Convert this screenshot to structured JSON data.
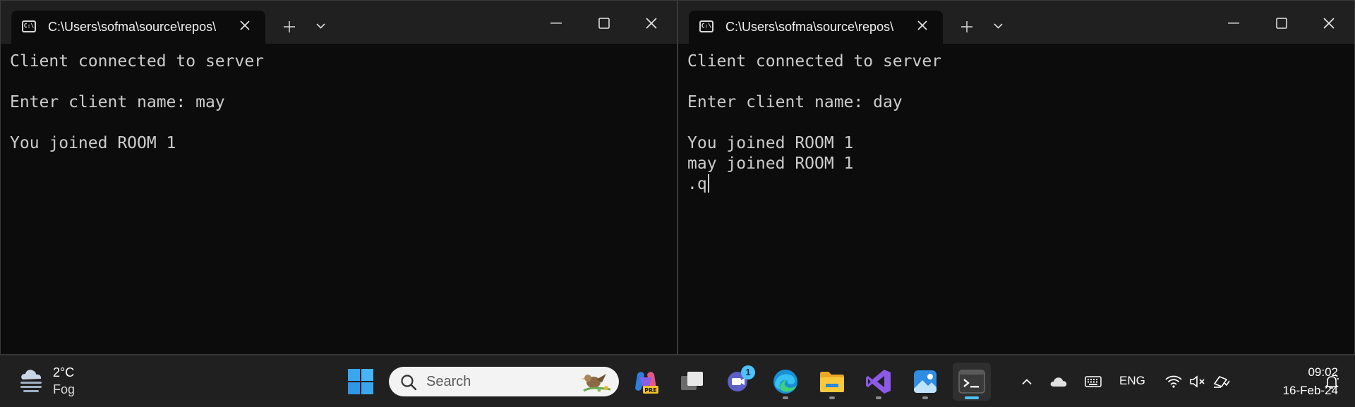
{
  "windows": [
    {
      "tab_title": "C:\\Users\\sofma\\source\\repos\\",
      "tab_icon_glyph": "C:\\",
      "lines": [
        "Client connected to server",
        "",
        "Enter client name: may",
        "",
        "You joined ROOM 1"
      ]
    },
    {
      "tab_title": "C:\\Users\\sofma\\source\\repos\\",
      "tab_icon_glyph": "C:\\",
      "lines": [
        "Client connected to server",
        "",
        "Enter client name: day",
        "",
        "You joined ROOM 1",
        "may joined ROOM 1",
        ".q"
      ]
    }
  ],
  "icons": {
    "tab": "terminal-tab-icon",
    "close_tab": "close-icon",
    "new_tab": "plus-icon",
    "dropdown": "chevron-down-icon",
    "minimize": "minimize-icon",
    "maximize": "maximize-icon",
    "close_window": "close-icon"
  },
  "taskbar": {
    "weather": {
      "temp": "2°C",
      "condition": "Fog",
      "icon": "fog-cloud-icon"
    },
    "search": {
      "label": "Search"
    },
    "apps": [
      {
        "name": "start",
        "icon": "windows-logo-icon"
      },
      {
        "name": "copilot",
        "icon": "copilot-pre-icon"
      },
      {
        "name": "task-view",
        "icon": "task-view-icon"
      },
      {
        "name": "teams",
        "icon": "teams-meet-icon",
        "badge": "1"
      },
      {
        "name": "edge",
        "icon": "edge-browser-icon"
      },
      {
        "name": "file-explorer",
        "icon": "folder-icon"
      },
      {
        "name": "visual-studio",
        "icon": "visual-studio-icon"
      },
      {
        "name": "photos",
        "icon": "photos-icon"
      },
      {
        "name": "terminal",
        "icon": "terminal-icon"
      }
    ],
    "tray": {
      "language": "ENG",
      "time": "09:02",
      "date": "16-Feb-24"
    }
  },
  "colors": {
    "console_bg": "#0c0c0c",
    "console_text": "#cccccc",
    "titlebar": "#202020",
    "taskbar": "#202020",
    "accent": "#4cc2ff"
  }
}
